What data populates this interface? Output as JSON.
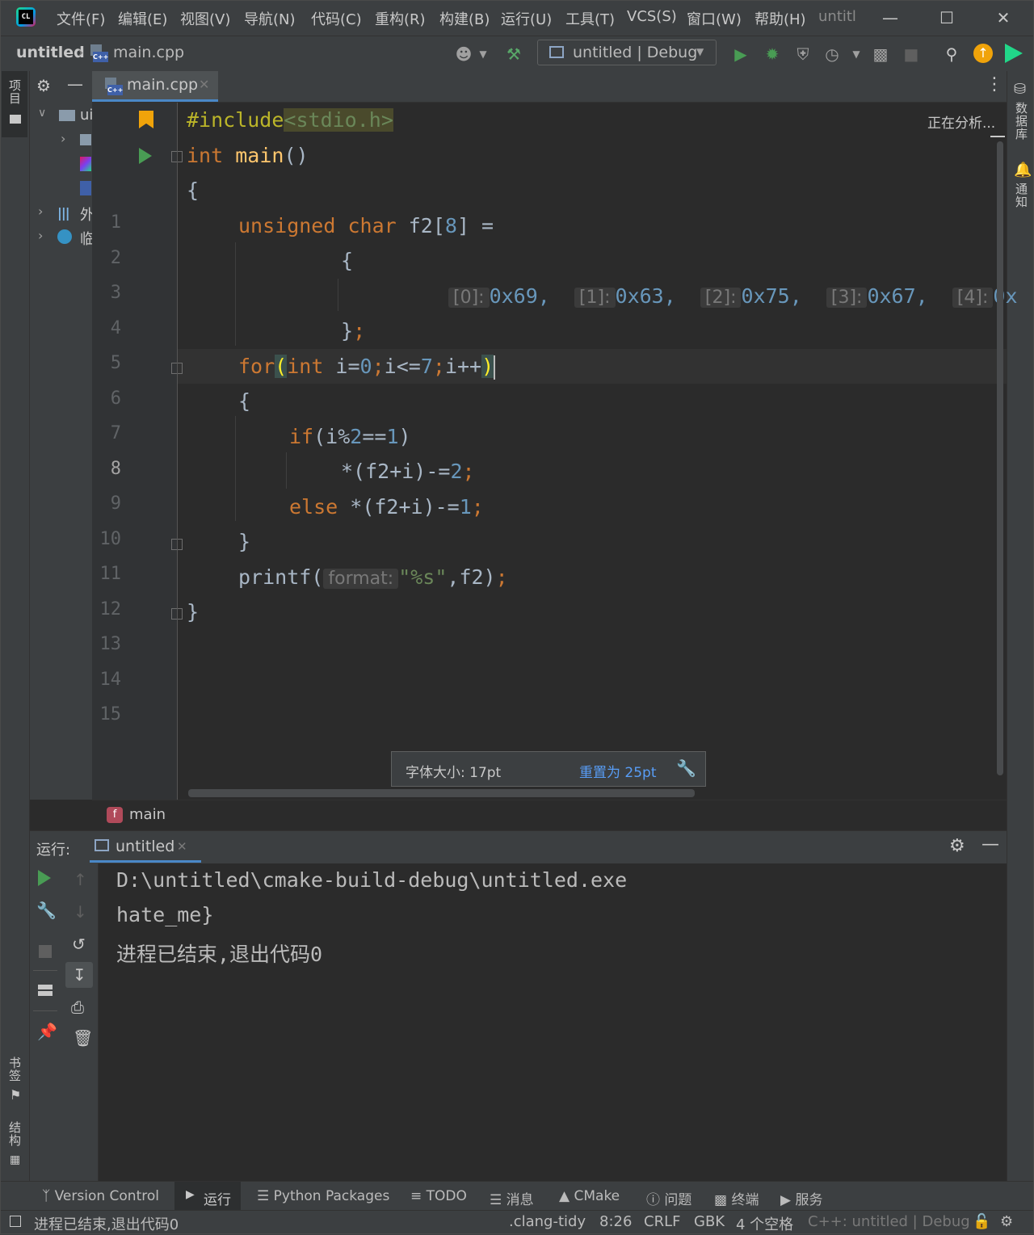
{
  "menu": {
    "items": [
      "文件(F)",
      "编辑(E)",
      "视图(V)",
      "导航(N)",
      "代码(C)",
      "重构(R)",
      "构建(B)",
      "运行(U)",
      "工具(T)",
      "VCS(S)",
      "窗口(W)",
      "帮助(H)"
    ],
    "window_title": "untitl"
  },
  "nav": {
    "project": "untitled",
    "file": "main.cpp",
    "run_config": "untitled | Debug"
  },
  "project_panel": {
    "items": [
      "ui",
      "外",
      "临"
    ]
  },
  "left_stripe": {
    "project": "项目",
    "bookmarks": "书签",
    "structure": "结构"
  },
  "right_stripe": {
    "database": "数据库",
    "notifications": "通知"
  },
  "editor": {
    "tab": "main.cpp",
    "analyzing": "正在分析...",
    "line_numbers": [
      "1",
      "2",
      "3",
      "4",
      "5",
      "6",
      "7",
      "8",
      "9",
      "10",
      "11",
      "12",
      "13",
      "14",
      "15"
    ],
    "code": {
      "l1_directive": "#include",
      "l1_header": "<stdio.h>",
      "l2_type": "int",
      "l2_name": "main",
      "l2_rest": "()",
      "l3": "{",
      "l4_kw": "unsigned char",
      "l4_name": " f2[",
      "l4_num": "8",
      "l4_rest": "] =",
      "l5": "{",
      "l6_hints": [
        {
          "index": "[0]:",
          "value": "0x69,"
        },
        {
          "index": "[1]:",
          "value": "0x63,"
        },
        {
          "index": "[2]:",
          "value": "0x75,"
        },
        {
          "index": "[3]:",
          "value": "0x67,"
        },
        {
          "index": "[4]:",
          "value": "0x"
        }
      ],
      "l7_brace": "}",
      "l7_semi": ";",
      "l8_for": "for",
      "l8_p1": "(",
      "l8_int": "int",
      "l8_a": " i=",
      "l8_n0": "0",
      "l8_s1": ";",
      "l8_b": "i<=",
      "l8_n7": "7",
      "l8_s2": ";",
      "l8_c": "i++",
      "l8_p2": ")",
      "l9": "{",
      "l10_if": "if",
      "l10_a": "(i%",
      "l10_n2": "2",
      "l10_b": "==",
      "l10_n1": "1",
      "l10_c": ")",
      "l11_a": "*(f2+i)-=",
      "l11_n": "2",
      "l11_s": ";",
      "l12_else": "else",
      "l12_a": " *(f2+i)-=",
      "l12_n": "1",
      "l12_s": ";",
      "l13": "}",
      "l14_fn": "printf(",
      "l14_hint": "format:",
      "l14_str": "\"%s\"",
      "l14_rest": ",f2)",
      "l14_s": ";",
      "l15": "}"
    },
    "font_popup": {
      "label": "字体大小: 17pt",
      "reset": "重置为 25pt"
    },
    "breadcrumb": "main"
  },
  "run": {
    "label": "运行:",
    "tab": "untitled",
    "output": [
      "D:\\untitled\\cmake-build-debug\\untitled.exe",
      "hate_me}",
      "进程已结束,退出代码0"
    ]
  },
  "bottom_tools": [
    "Version Control",
    "运行",
    "Python Packages",
    "TODO",
    "消息",
    "CMake",
    "问题",
    "终端",
    "服务"
  ],
  "status": {
    "message": "进程已结束,退出代码0",
    "linter": ".clang-tidy",
    "position": "8:26",
    "line_sep": "CRLF",
    "encoding": "GBK",
    "indent": "4 个空格",
    "context": "C++: untitled | Debug"
  }
}
